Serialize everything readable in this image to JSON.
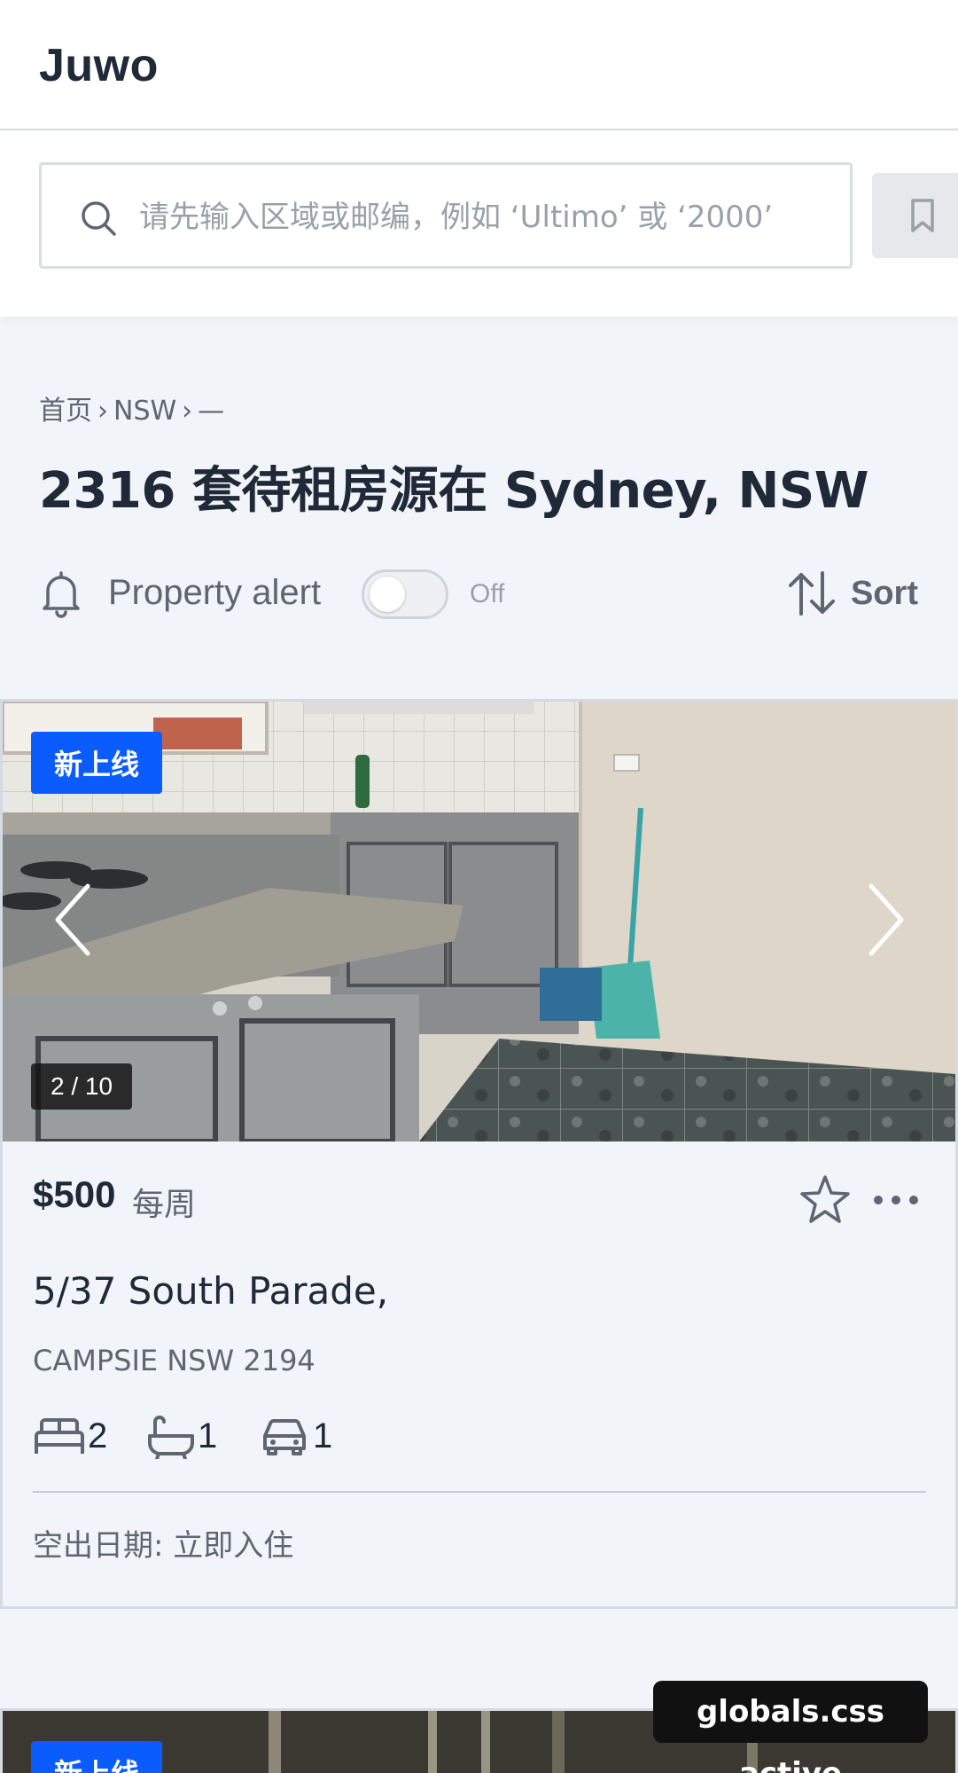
{
  "header": {
    "brand": "Juwo"
  },
  "search": {
    "placeholder": "请先输入区域或邮编，例如 ‘Ultimo’ 或 ‘2000’",
    "value": ""
  },
  "breadcrumb": {
    "items": [
      "首页",
      "NSW",
      "—"
    ],
    "separator": "›"
  },
  "page": {
    "title": "2316 套待租房源在 Sydney, NSW"
  },
  "alert": {
    "label": "Property alert",
    "state": "Off",
    "enabled": false
  },
  "sort": {
    "label": "Sort"
  },
  "listings": [
    {
      "badge": "新上线",
      "image_counter": "2 / 10",
      "price": "$500",
      "period": "每周",
      "street": "5/37 South Parade,",
      "suburb": "CAMPSIE NSW 2194",
      "bedrooms": "2",
      "bathrooms": "1",
      "parking": "1",
      "availability": "空出日期: 立即入住",
      "icons": [
        "bed-icon",
        "bath-icon",
        "car-icon",
        "star-icon",
        "more-icon",
        "chevron-left-icon",
        "chevron-right-icon"
      ]
    },
    {
      "badge": "新上线"
    }
  ],
  "toast": {
    "text": "globals.css active"
  },
  "colors": {
    "accent": "#0b5cff",
    "text": "#1f2937",
    "muted": "#5f6671",
    "background": "#f1f4f8"
  }
}
